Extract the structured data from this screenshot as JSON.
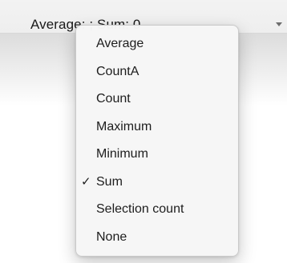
{
  "status_bar": {
    "text": "Average: ; Sum: 0"
  },
  "menu": {
    "items": [
      {
        "label": "Average",
        "checked": false
      },
      {
        "label": "CountA",
        "checked": false
      },
      {
        "label": "Count",
        "checked": false
      },
      {
        "label": "Maximum",
        "checked": false
      },
      {
        "label": "Minimum",
        "checked": false
      },
      {
        "label": "Sum",
        "checked": true
      },
      {
        "label": "Selection count",
        "checked": false
      },
      {
        "label": "None",
        "checked": false
      }
    ],
    "check_glyph": "✓"
  }
}
